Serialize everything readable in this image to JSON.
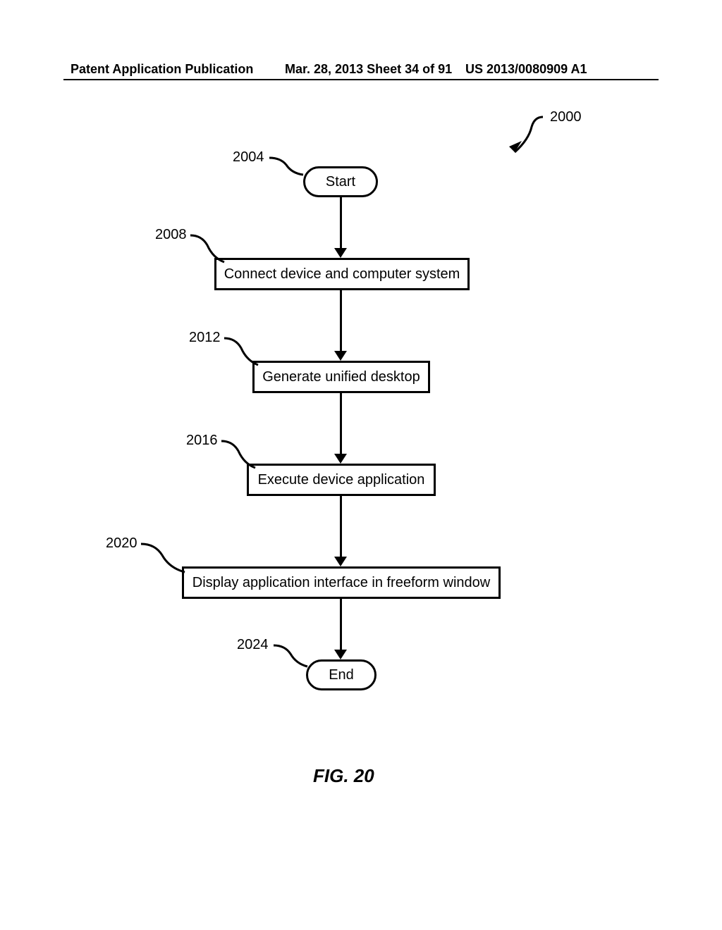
{
  "header": {
    "left": "Patent Application Publication",
    "middle": "Mar. 28, 2013  Sheet 34 of 91",
    "right": "US 2013/0080909 A1"
  },
  "refs": {
    "overall": "2000",
    "start": "2004",
    "step1": "2008",
    "step2": "2012",
    "step3": "2016",
    "step4": "2020",
    "end": "2024"
  },
  "nodes": {
    "start": "Start",
    "step1": "Connect device and computer system",
    "step2": "Generate unified desktop",
    "step3": "Execute device application",
    "step4": "Display application interface in freeform window",
    "end": "End"
  },
  "figure_caption": "FIG. 20"
}
